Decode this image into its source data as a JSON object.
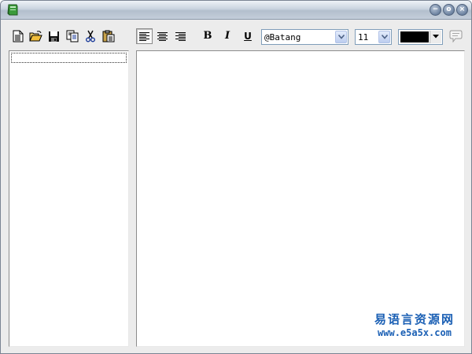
{
  "titlebar": {
    "icon": "green-book-icon",
    "buttons": [
      "minimize-icon",
      "maximize-icon",
      "close-icon"
    ],
    "min_symbol": "−",
    "max_symbol": "o",
    "close_symbol": "×"
  },
  "toolbar": {
    "file_buttons": [
      "new-document-icon",
      "open-folder-icon",
      "save-icon",
      "copy-icon",
      "cut-icon",
      "paste-icon"
    ],
    "align_buttons": [
      "align-left-icon",
      "align-center-icon",
      "align-right-icon"
    ],
    "bold_label": "B",
    "italic_label": "I",
    "underline_label": "U",
    "font_name": "@Batang",
    "font_size": "11",
    "text_color": "#000000",
    "extra_icon": "speech-bubble-icon"
  },
  "watermark": {
    "chinese": "易语言资源网",
    "url": "www.e5a5x.com"
  },
  "colors": {
    "watermark": "#1a5fb4",
    "window_bg": "#ececec"
  }
}
